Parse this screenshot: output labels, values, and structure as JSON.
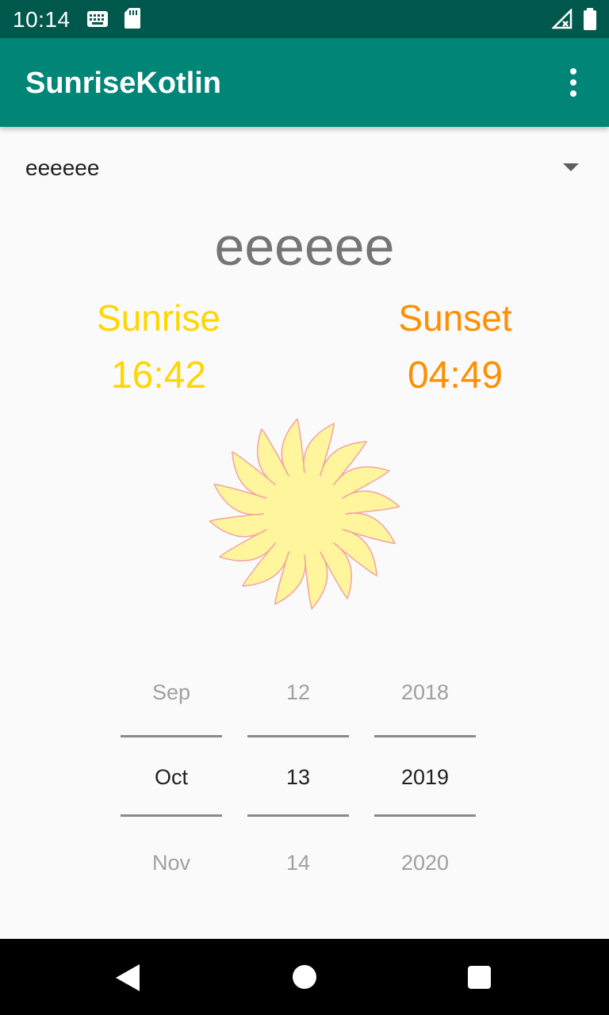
{
  "status_bar": {
    "time": "10:14",
    "icons": [
      "keyboard-icon",
      "sd-card-icon",
      "signal-no-data-icon",
      "battery-icon"
    ],
    "background": "#00574b"
  },
  "app_bar": {
    "title": "SunriseKotlin",
    "menu_icon": "overflow-menu-icon",
    "background": "#008577"
  },
  "spinner": {
    "selected_value": "eeeeee",
    "arrow_icon": "dropdown-arrow-icon"
  },
  "location": {
    "title": "eeeeee"
  },
  "sunrise": {
    "label": "Sunrise",
    "time": "16:42",
    "color": "#ffd600"
  },
  "sunset": {
    "label": "Sunset",
    "time": "04:49",
    "color": "#ff8f00"
  },
  "sun_image": {
    "icon": "sun-icon"
  },
  "date_picker": {
    "month": {
      "prev": "Sep",
      "selected": "Oct",
      "next": "Nov"
    },
    "day": {
      "prev": "12",
      "selected": "13",
      "next": "14"
    },
    "year": {
      "prev": "2018",
      "selected": "2019",
      "next": "2020"
    }
  },
  "nav_bar": {
    "buttons": [
      "back-icon",
      "home-icon",
      "recents-icon"
    ]
  }
}
